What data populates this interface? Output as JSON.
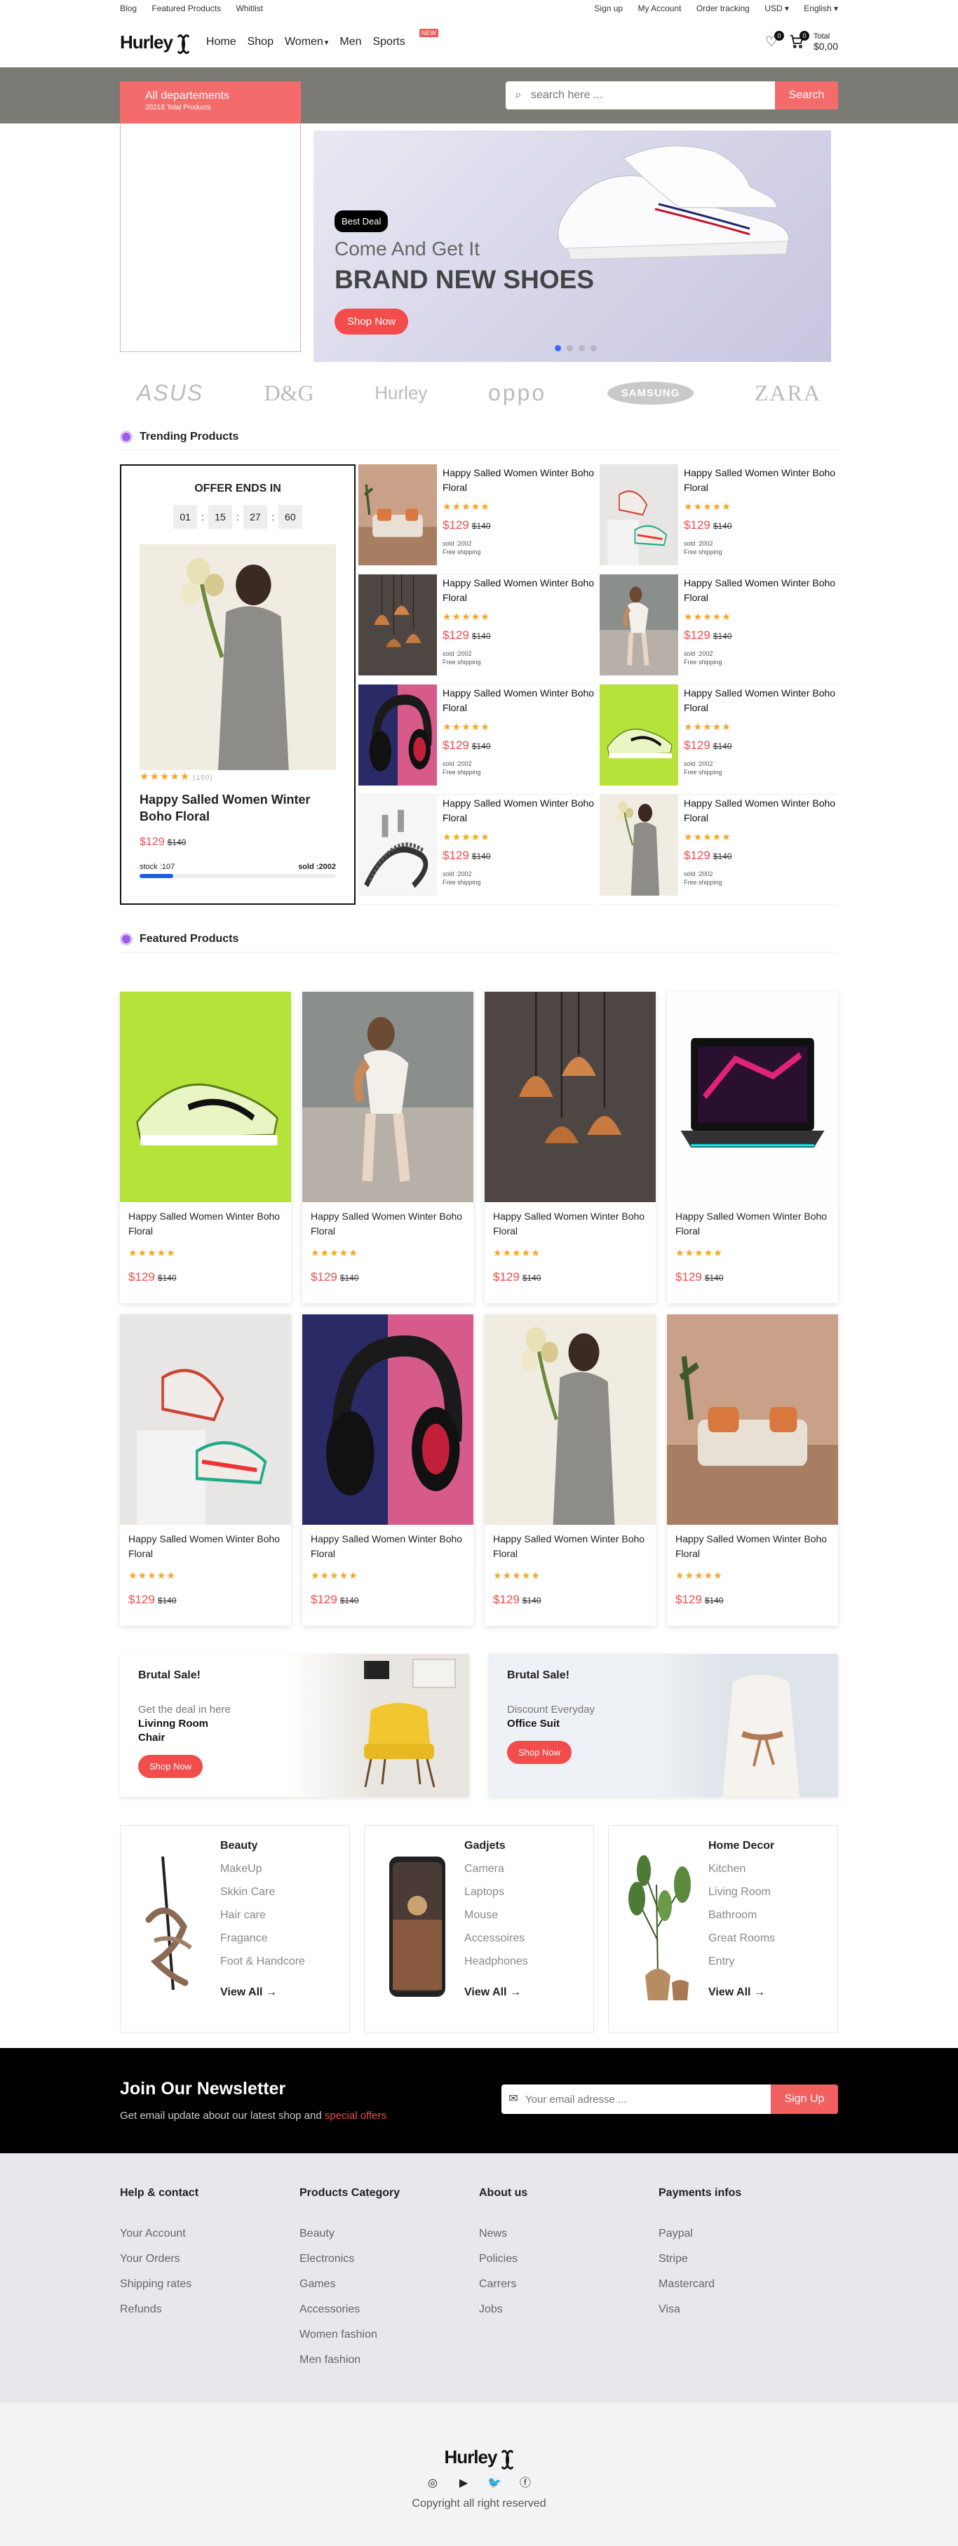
{
  "topbar": {
    "left": [
      "Blog",
      "Featured Products",
      "Whitlist"
    ],
    "right": [
      "Sign up",
      "My Account",
      "Order tracking",
      "USD",
      "English"
    ]
  },
  "header": {
    "logo": "Hurley",
    "nav": [
      "Home",
      "Shop",
      "Women",
      "Men",
      "Sports"
    ],
    "new_badge": "NEW",
    "wishlist_count": "0",
    "cart_count": "0",
    "total_label": "Total",
    "total_value": "$0,00"
  },
  "search": {
    "dept_title": "All departements",
    "dept_sub": "20218 Total Products",
    "placeholder": "search here ...",
    "button": "Search"
  },
  "hero": {
    "badge": "Best Deal",
    "line1": "Come And Get It",
    "line2": "BRAND NEW SHOES",
    "button": "Shop Now"
  },
  "brands": [
    "ASUS",
    "D&G",
    "Hurley",
    "oppo",
    "SAMSUNG",
    "ZARA"
  ],
  "trending": {
    "title": "Trending Products",
    "offer": {
      "heading": "OFFER ENDS IN",
      "timer": [
        "01",
        "15",
        "27",
        "60"
      ],
      "reviews": "(150)",
      "name": "Happy Salled Women Winter Boho Floral",
      "price": "$129",
      "old_price": "$140",
      "stock": "stock :107",
      "sold": "sold :2002",
      "stock_fraction": 0.17
    },
    "items": [
      {
        "name": "Happy Salled Women Winter Boho Floral",
        "price": "$129",
        "old": "$140",
        "sold": "sold :2002",
        "ship": "Free shipping",
        "img": "sofa"
      },
      {
        "name": "Happy Salled Women Winter Boho Floral",
        "price": "$129",
        "old": "$140",
        "sold": "sold :2002",
        "ship": "Free shipping",
        "img": "sneakers"
      },
      {
        "name": "Happy Salled Women Winter Boho Floral",
        "price": "$129",
        "old": "$140",
        "sold": "sold :2002",
        "ship": "Free shipping",
        "img": "lamps"
      },
      {
        "name": "Happy Salled Women Winter Boho Floral",
        "price": "$129",
        "old": "$140",
        "sold": "sold :2002",
        "ship": "Free shipping",
        "img": "woman-rocks"
      },
      {
        "name": "Happy Salled Women Winter Boho Floral",
        "price": "$129",
        "old": "$140",
        "sold": "sold :2002",
        "ship": "Free shipping",
        "img": "headphones"
      },
      {
        "name": "Happy Salled Women Winter Boho Floral",
        "price": "$129",
        "old": "$140",
        "sold": "sold :2002",
        "ship": "Free shipping",
        "img": "green-shoe"
      },
      {
        "name": "Happy Salled Women Winter Boho Floral",
        "price": "$129",
        "old": "$140",
        "sold": "sold :2002",
        "ship": "Free shipping",
        "img": "cable"
      },
      {
        "name": "Happy Salled Women Winter Boho Floral",
        "price": "$129",
        "old": "$140",
        "sold": "sold :2002",
        "ship": "Free shipping",
        "img": "woman-flowers"
      }
    ]
  },
  "featured": {
    "title": "Featured Products",
    "items": [
      {
        "name": "Happy Salled Women Winter Boho Floral",
        "price": "$129",
        "old": "$140",
        "img": "green-shoe"
      },
      {
        "name": "Happy Salled Women Winter Boho Floral",
        "price": "$129",
        "old": "$140",
        "img": "woman-rocks"
      },
      {
        "name": "Happy Salled Women Winter Boho Floral",
        "price": "$129",
        "old": "$140",
        "img": "lamps"
      },
      {
        "name": "Happy Salled Women Winter Boho Floral",
        "price": "$129",
        "old": "$140",
        "img": "laptop"
      },
      {
        "name": "Happy Salled Women Winter Boho Floral",
        "price": "$129",
        "old": "$140",
        "img": "sneakers"
      },
      {
        "name": "Happy Salled Women Winter Boho Floral",
        "price": "$129",
        "old": "$140",
        "img": "headphones"
      },
      {
        "name": "Happy Salled Women Winter Boho Floral",
        "price": "$129",
        "old": "$140",
        "img": "woman-flowers"
      },
      {
        "name": "Happy Salled Women Winter Boho Floral",
        "price": "$129",
        "old": "$140",
        "img": "sofa"
      }
    ]
  },
  "sales": [
    {
      "title": "Brutal Sale!",
      "line1": "Get the deal in here",
      "line2": "Livinng Room Chair",
      "button": "Shop Now"
    },
    {
      "title": "Brutal Sale!",
      "line1": "Discount Everyday",
      "line2": "Office Suit",
      "button": "Shop Now"
    }
  ],
  "categories": [
    {
      "title": "Beauty",
      "items": [
        "MakeUp",
        "Skkin Care",
        "Hair care",
        "Fragance",
        "Foot & Handcore"
      ],
      "view": "View All"
    },
    {
      "title": "Gadjets",
      "items": [
        "Camera",
        "Laptops",
        "Mouse",
        "Accessoires",
        "Headphones"
      ],
      "view": "View All"
    },
    {
      "title": "Home Decor",
      "items": [
        "Kitchen",
        "Living Room",
        "Bathroom",
        "Great Rooms",
        "Entry"
      ],
      "view": "View All"
    }
  ],
  "newsletter": {
    "title": "Join Our Newsletter",
    "text": "Get email update about our latest shop and",
    "highlight": "special offers",
    "placeholder": "Your email adresse ...",
    "button": "Sign Up"
  },
  "footer": [
    {
      "title": "Help & contact",
      "items": [
        "Your Account",
        "Your Orders",
        "Shipping rates",
        "Refunds"
      ]
    },
    {
      "title": "Products Category",
      "items": [
        "Beauty",
        "Electronics",
        "Games",
        "Accessories",
        "Women fashion",
        "Men fashion"
      ]
    },
    {
      "title": "About us",
      "items": [
        "News",
        "Policies",
        "Carrers",
        "Jobs"
      ]
    },
    {
      "title": "Payments infos",
      "items": [
        "Paypal",
        "Stripe",
        "Mastercard",
        "Visa"
      ]
    }
  ],
  "bottom": {
    "logo": "Hurley",
    "socials": [
      "instagram-icon",
      "youtube-icon",
      "twitter-icon",
      "facebook-icon"
    ],
    "copyright": "Copyright all right reserved"
  },
  "colors": {
    "accent": "#f46b6b",
    "band": "#7c7a75",
    "star": "#f6a623"
  }
}
